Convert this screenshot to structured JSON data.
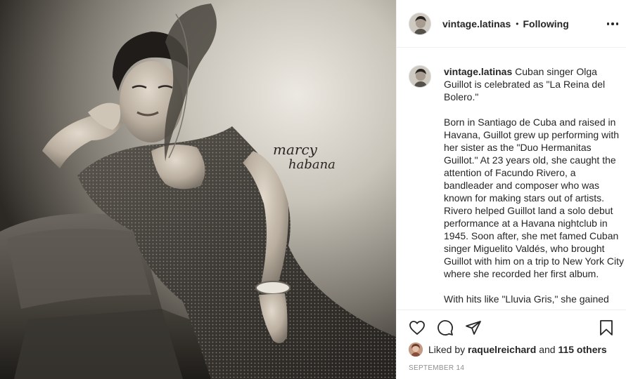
{
  "photo": {
    "alt": "Vintage portrait of a woman reclining on a sofa",
    "signature_line1": "marcy",
    "signature_line2": "habana"
  },
  "header": {
    "username": "vintage.latinas",
    "separator": "•",
    "follow_label": "Following",
    "more_icon": "more-horizontal-icon"
  },
  "caption": {
    "username": "vintage.latinas",
    "paragraphs": [
      "Cuban singer Olga Guillot is celebrated as \"La Reina del Bolero.\"",
      "Born in Santiago de Cuba and raised in Havana, Guillot grew up performing with her sister as the \"Duo Hermanitas Guillot.\" At 23 years old, she caught the attention of Facundo Rivero, a bandleader and composer who was known for making stars out of artists. Rivero helped Guillot land a solo debut performance at a Havana nightclub in 1945. Soon after, she met famed Cuban singer Miguelito Valdés, who brought Guillot with him on a trip to New York City where she recorded her first album.",
      "With hits like \"Lluvia Gris,\" she gained"
    ]
  },
  "actions": {
    "icons": [
      "heart-icon",
      "comment-icon",
      "share-icon",
      "bookmark-icon"
    ]
  },
  "likes": {
    "prefix": "Liked by",
    "user": "raquelreichard",
    "conj": "and",
    "others": "115 others"
  },
  "date": "SEPTEMBER 14",
  "colors": {
    "text": "#262626",
    "muted": "#8e8e8e",
    "border": "#efefef"
  }
}
